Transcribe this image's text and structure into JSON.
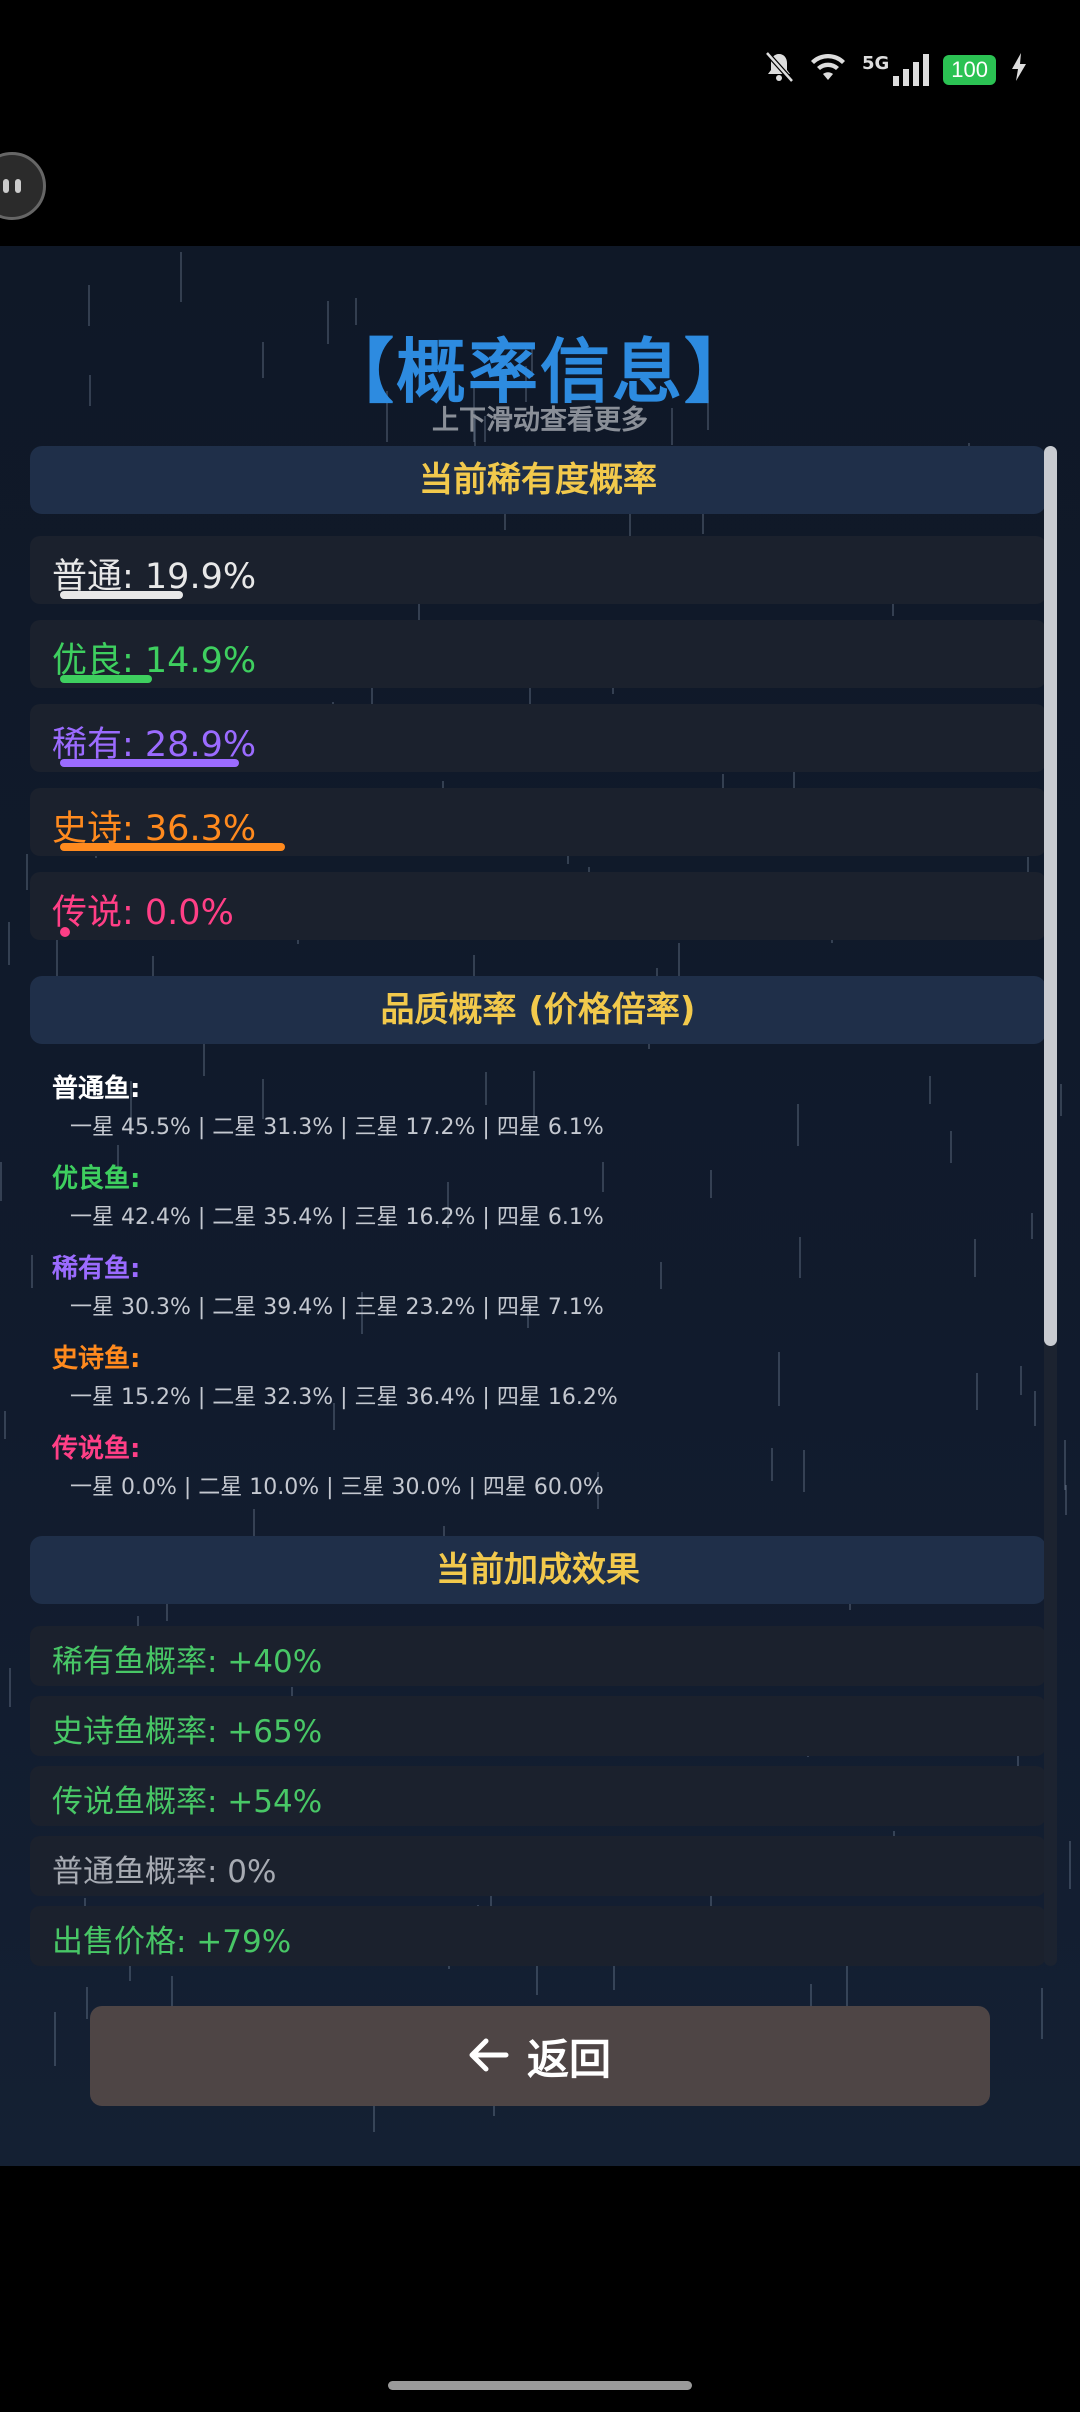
{
  "status": {
    "network": "5G",
    "battery": "100"
  },
  "header": {
    "title": "【概率信息】",
    "subtitle": "上下滑动查看更多"
  },
  "rarity": {
    "title": "当前稀有度概率",
    "items": [
      {
        "label": "普通: 19.9%",
        "color": "#e8e8e8",
        "value": 0.199
      },
      {
        "label": "优良: 14.9%",
        "color": "#3ecf5f",
        "value": 0.149
      },
      {
        "label": "稀有: 28.9%",
        "color": "#9b6bff",
        "value": 0.289
      },
      {
        "label": "史诗: 36.3%",
        "color": "#ff8a1e",
        "value": 0.363
      },
      {
        "label": "传说: 0.0%",
        "color": "#ff3f86",
        "value": 0.0
      }
    ]
  },
  "quality": {
    "title": "品质概率 (价格倍率)",
    "items": [
      {
        "name": "普通鱼:",
        "color": "#ffffff",
        "values": "一星 45.5% | 二星 31.3% | 三星 17.2% | 四星 6.1%"
      },
      {
        "name": "优良鱼:",
        "color": "#3ecf5f",
        "values": "一星 42.4% | 二星 35.4% | 三星 16.2% | 四星 6.1%"
      },
      {
        "name": "稀有鱼:",
        "color": "#9b6bff",
        "values": "一星 30.3% | 二星 39.4% | 三星 23.2% | 四星 7.1%"
      },
      {
        "name": "史诗鱼:",
        "color": "#ff8a1e",
        "values": "一星 15.2% | 二星 32.3% | 三星 36.4% | 四星 16.2%"
      },
      {
        "name": "传说鱼:",
        "color": "#ff3f86",
        "values": "一星 0.0% | 二星 10.0% | 三星 30.0% | 四星 60.0%"
      }
    ]
  },
  "bonus": {
    "title": "当前加成效果",
    "items": [
      {
        "label": "稀有鱼概率: +40%",
        "color": "#48c766"
      },
      {
        "label": "史诗鱼概率: +65%",
        "color": "#48c766"
      },
      {
        "label": "传说鱼概率: +54%",
        "color": "#48c766"
      },
      {
        "label": "普通鱼概率: 0%",
        "color": "#a7abb3"
      },
      {
        "label": "出售价格: +79%",
        "color": "#48c766"
      }
    ]
  },
  "footer": {
    "back_label": "返回",
    "back_icon": "arrow-left-icon"
  }
}
